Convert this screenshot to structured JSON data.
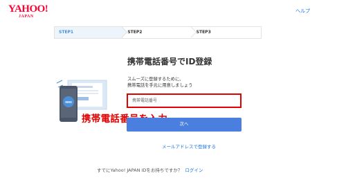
{
  "header": {
    "logo_main": "YAHOO!",
    "logo_sub": "JAPAN",
    "help_link": "ヘルプ"
  },
  "steps": [
    {
      "label": "STEP1",
      "active": true
    },
    {
      "label": "STEP2",
      "active": false
    },
    {
      "label": "STEP3",
      "active": false
    }
  ],
  "main": {
    "title": "携帯電話番号でID登録",
    "description_line1": "スムーズに登録するために、",
    "description_line2": "携帯電話を手元に用意しましょう",
    "phone_placeholder": "携帯電話番号",
    "annotation": "携帯電話番号を入力",
    "next_button": "次へ",
    "email_register_link": "メールアドレスで登録する",
    "sms_badge": "SMS"
  },
  "footer": {
    "question": "すでにYahoo! JAPAN IDをお持ちですか？",
    "login_link": "ログイン"
  },
  "colors": {
    "brand_red": "#ff0033",
    "link_blue": "#1a73e8",
    "button_blue": "#4a7fe0",
    "highlight_red": "#e00000"
  }
}
